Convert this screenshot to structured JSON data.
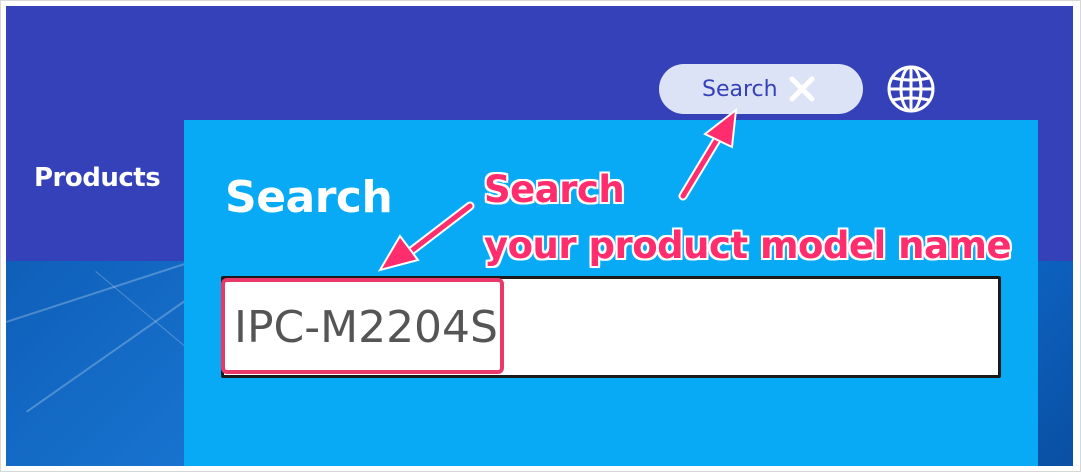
{
  "nav": {
    "products_label": "Products"
  },
  "header": {
    "search_pill_label": "Search",
    "close_icon": "close-icon",
    "globe_icon": "globe-icon"
  },
  "search_panel": {
    "title": "Search",
    "input_value": "IPC-M2204S"
  },
  "annotation": {
    "line1": "Search",
    "line2": "your product model name",
    "color": "#ff2d6e"
  },
  "colors": {
    "header_bg": "#3441b8",
    "panel_bg": "#08aaf5",
    "pill_bg": "#dde3f6",
    "highlight": "#e8396a"
  }
}
